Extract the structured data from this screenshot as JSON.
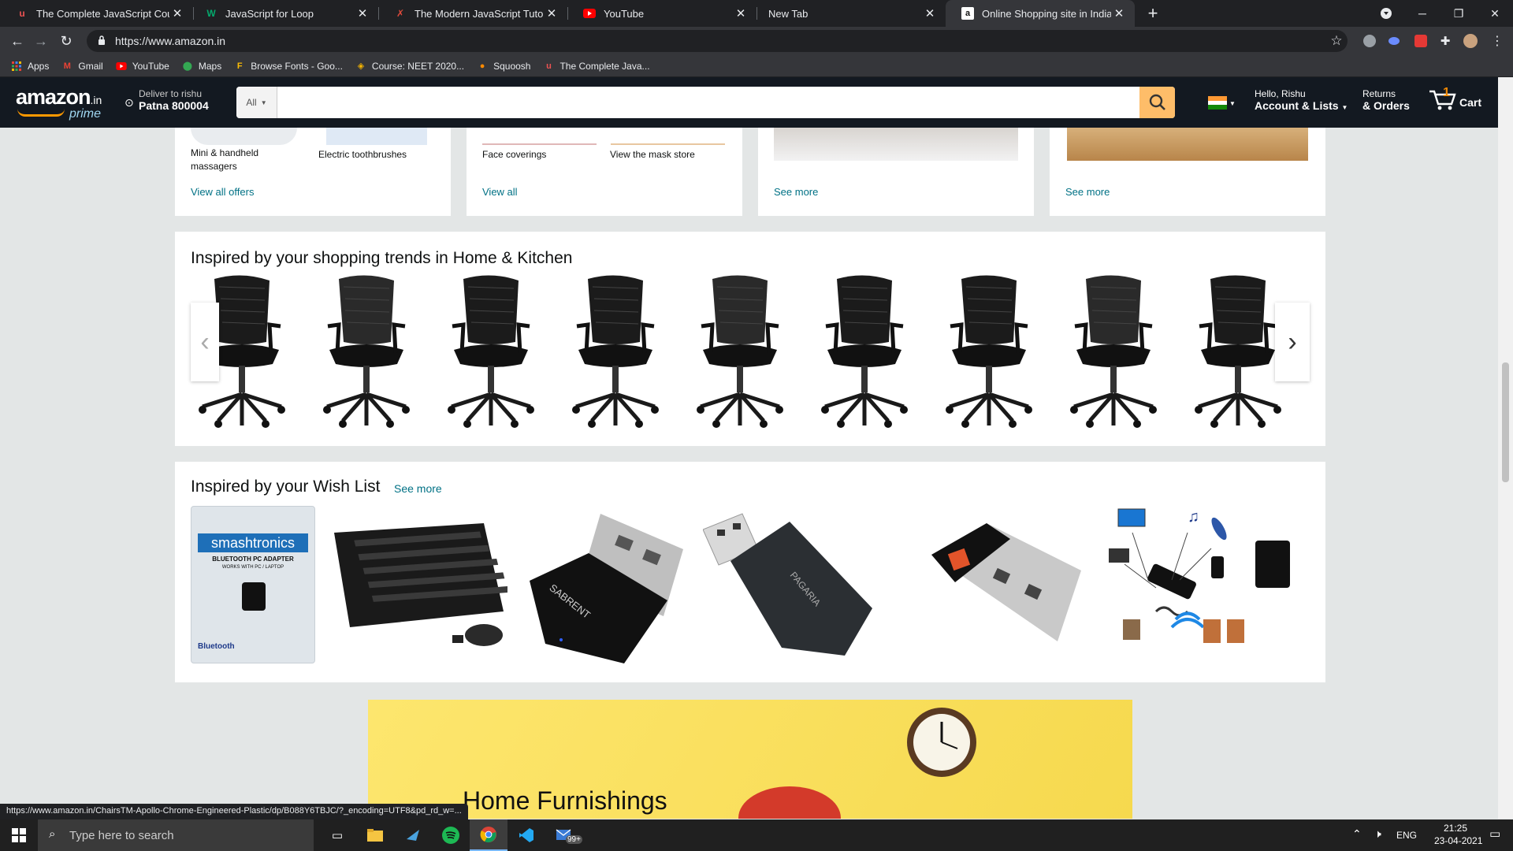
{
  "browser": {
    "tabs": [
      {
        "title": "The Complete JavaScript Course",
        "icon": "udemy-icon"
      },
      {
        "title": "JavaScript for Loop",
        "icon": "w3-icon"
      },
      {
        "title": "The Modern JavaScript Tutorial",
        "icon": "js-info-icon"
      },
      {
        "title": "YouTube",
        "icon": "youtube-icon"
      },
      {
        "title": "New Tab",
        "icon": ""
      },
      {
        "title": "Online Shopping site in India: Sh",
        "icon": "amazon-icon"
      }
    ],
    "new_tab_glyph": "+",
    "url": "https://www.amazon.in",
    "bookmarks": [
      {
        "label": "Apps",
        "icon": "apps-grid-icon"
      },
      {
        "label": "Gmail",
        "icon": "gmail-icon"
      },
      {
        "label": "YouTube",
        "icon": "youtube-icon"
      },
      {
        "label": "Maps",
        "icon": "maps-icon"
      },
      {
        "label": "Browse Fonts - Goo...",
        "icon": "fonts-icon"
      },
      {
        "label": "Course: NEET 2020...",
        "icon": "course-icon"
      },
      {
        "label": "Squoosh",
        "icon": "squoosh-icon"
      },
      {
        "label": "The Complete Java...",
        "icon": "udemy-icon"
      }
    ],
    "status_url": "https://www.amazon.in/ChairsTM-Apollo-Chrome-Engineered-Plastic/dp/B088Y6TBJC/?_encoding=UTF8&pd_rd_w=..."
  },
  "amazon": {
    "logo_text": "amazon",
    "logo_suffix": ".in",
    "logo_prime": "prime",
    "deliver_label": "Deliver to rishu",
    "deliver_city": "Patna 800004",
    "search_category": "All",
    "search_placeholder": "",
    "account_greeting": "Hello, Rishu",
    "account_label": "Account & Lists",
    "returns_label": "Returns",
    "orders_label": "& Orders",
    "cart_count": "1",
    "cart_label": "Cart",
    "colors": {
      "nav_bg": "#131921",
      "search_btn": "#febd69",
      "link": "#007185"
    }
  },
  "cards_top": [
    {
      "captions": [
        "Mini & handheld massagers",
        "Electric toothbrushes"
      ],
      "link": "View all offers"
    },
    {
      "captions": [
        "Face coverings",
        "View the mask store"
      ],
      "link": "View all"
    },
    {
      "captions": [],
      "link": "See more"
    },
    {
      "captions": [],
      "link": "See more"
    }
  ],
  "trends": {
    "title": "Inspired by your shopping trends in Home & Kitchen",
    "prev": "‹",
    "next": "›"
  },
  "wishlist": {
    "title": "Inspired by your Wish List",
    "see_more": "See more",
    "adapter_brand": "smashtronics",
    "adapter_line1": "BLUETOOTH PC ADAPTER",
    "adapter_line2": "WORKS WITH PC / LAPTOP",
    "adapter_badge": "Bluetooth",
    "sabrent_label": "SABRENT",
    "pagaria_label": "PAGARIA"
  },
  "banner": {
    "title": "Home Furnishings"
  },
  "taskbar": {
    "search_placeholder": "Type here to search",
    "mail_badge": "99+",
    "lang": "ENG",
    "time": "21:25",
    "date": "23-04-2021"
  }
}
